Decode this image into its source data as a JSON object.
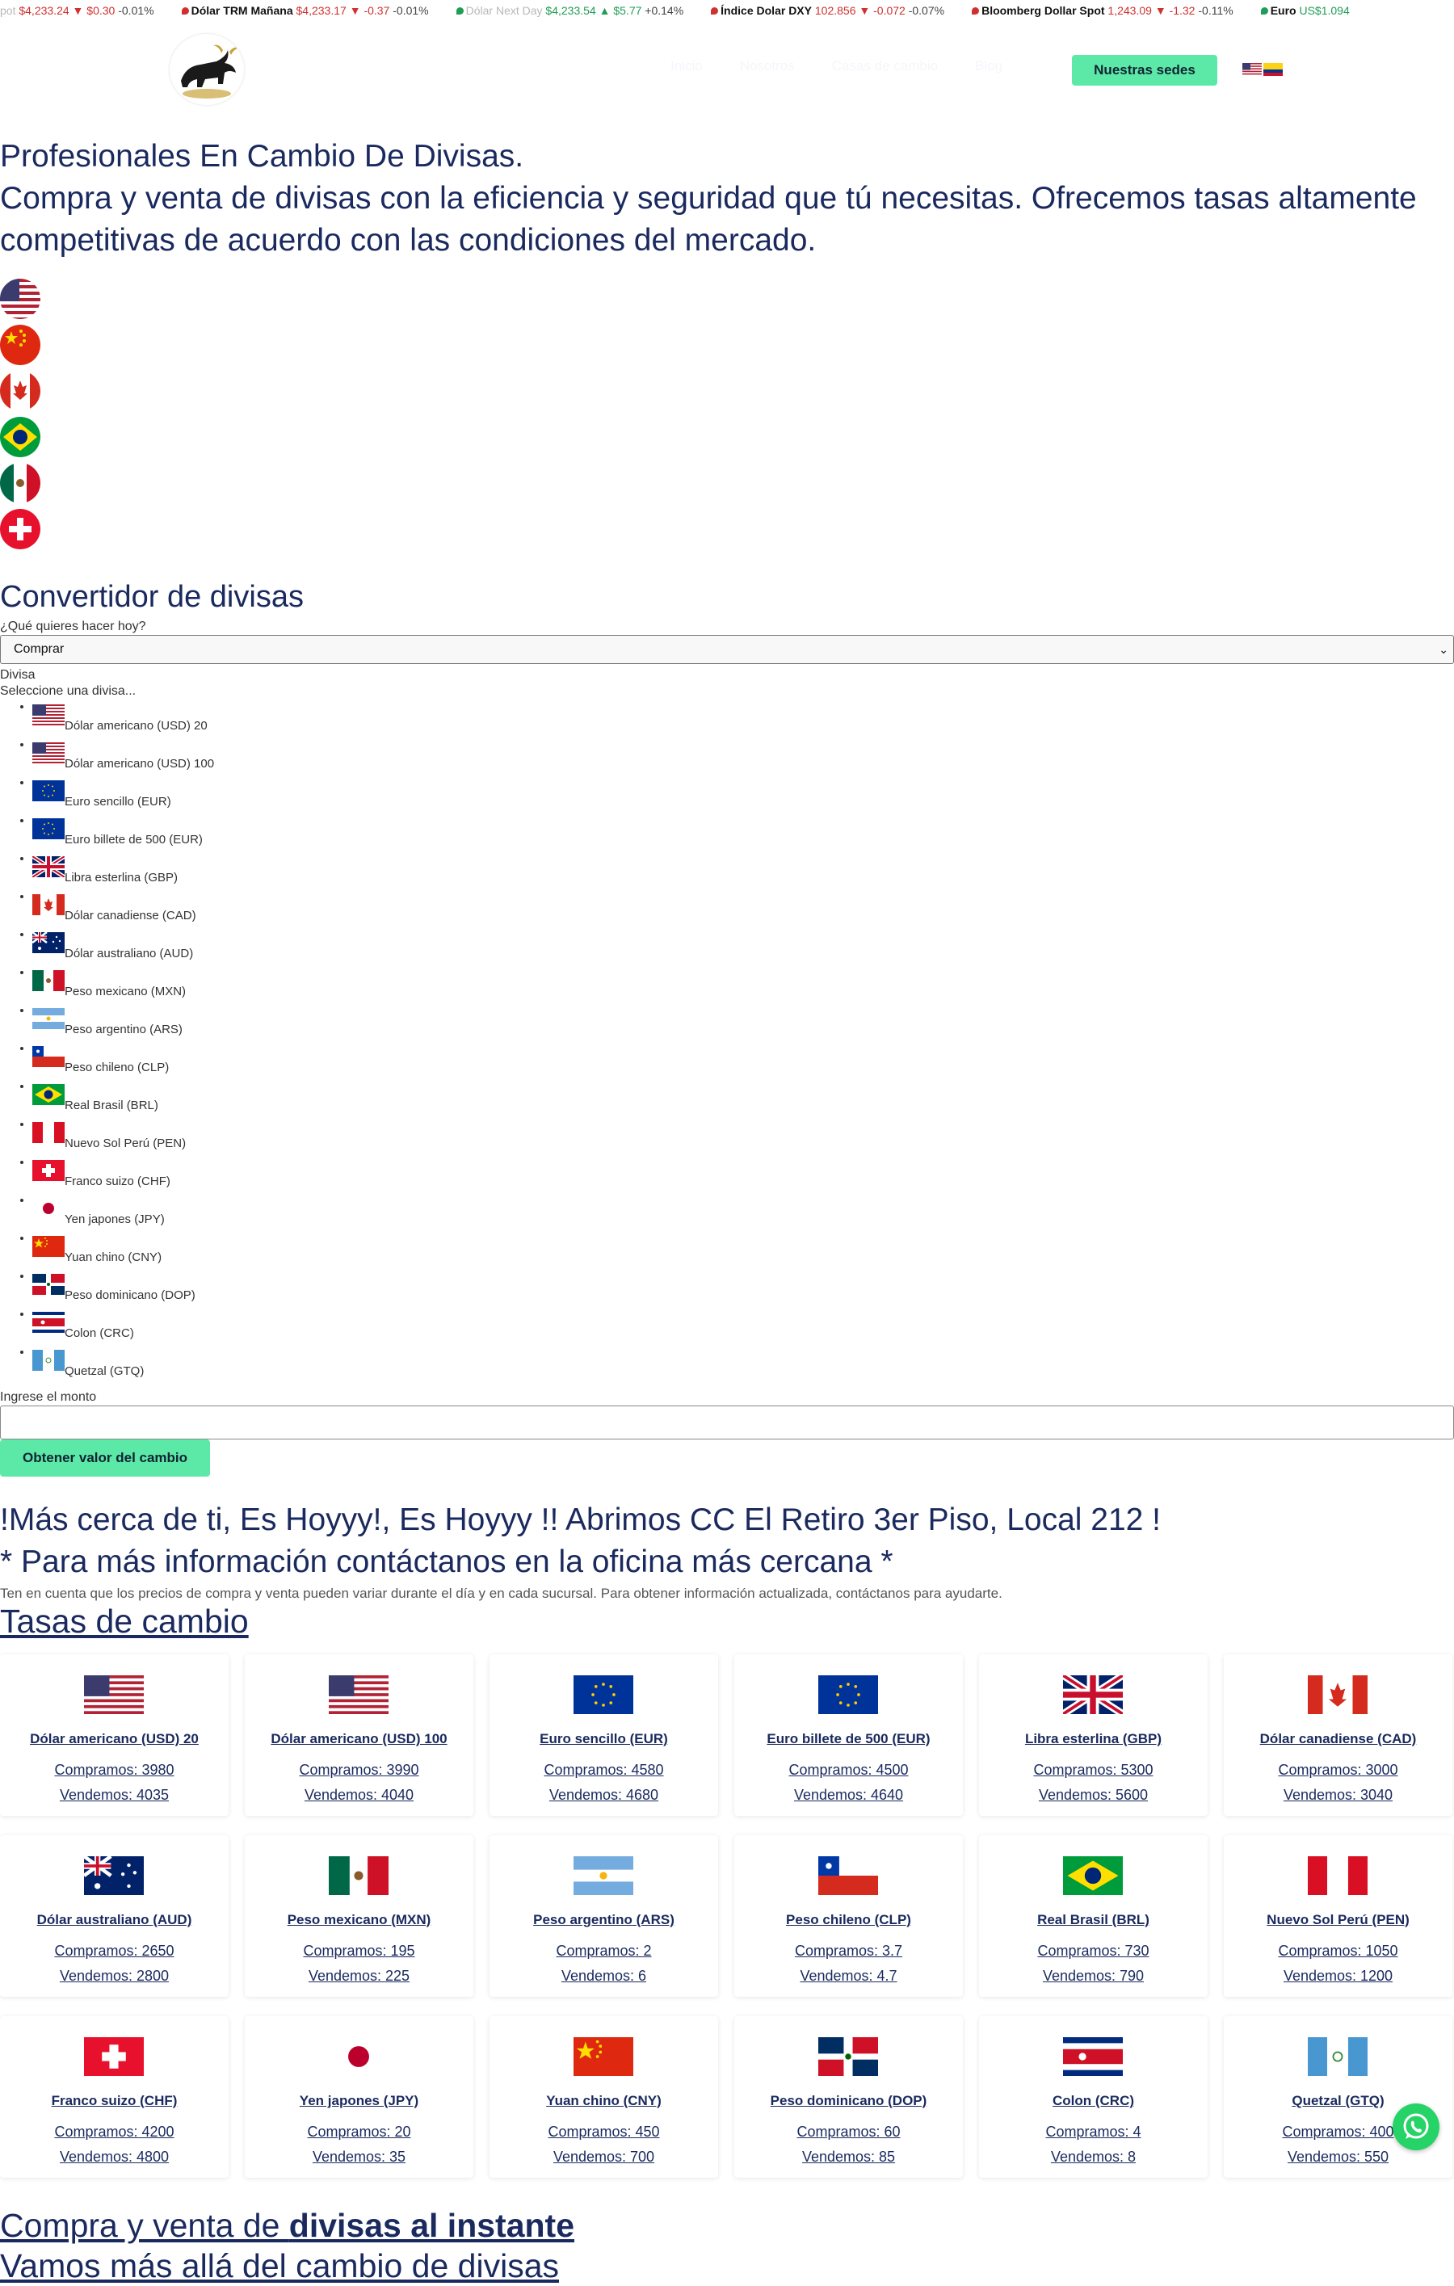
{
  "ticker": [
    {
      "pre": "pot",
      "name": "",
      "price": "$4,233.24",
      "dir": "down",
      "change": "$0.30",
      "pct": "-0.01%",
      "fade": true
    },
    {
      "pre": "",
      "name": "Dólar TRM Mañana",
      "price": "$4,233.17",
      "dir": "down",
      "change": "-0.37",
      "pct": "-0.01%"
    },
    {
      "pre": "",
      "name": "Dólar Next Day",
      "price": "$4,233.54",
      "dir": "up",
      "change": "$5.77",
      "pct": "+0.14%",
      "fade": true
    },
    {
      "pre": "",
      "name": "Índice Dolar DXY",
      "price": "102.856",
      "dir": "down",
      "change": "-0.072",
      "pct": "-0.07%"
    },
    {
      "pre": "",
      "name": "Bloomberg Dollar Spot",
      "price": "1,243.09",
      "dir": "down",
      "change": "-1.32",
      "pct": "-0.11%"
    },
    {
      "pre": "",
      "name": "Euro",
      "price": "US$1.094",
      "dir": "up",
      "change": "",
      "pct": ""
    }
  ],
  "nav": {
    "items": [
      "Inicio",
      "Nosotros",
      "Casas de cambio",
      "Blog"
    ],
    "sedes_label": "Nuestras sedes"
  },
  "hero": {
    "title": "Profesionales En Cambio De Divisas.",
    "subtitle": "Compra y venta de divisas con la eficiencia y seguridad que tú necesitas. Ofrecemos tasas altamente competitivas de acuerdo con las condiciones del mercado."
  },
  "converter": {
    "title": "Convertidor de divisas",
    "question": "¿Qué quieres hacer hoy?",
    "selected_action": "Comprar",
    "divisa_label": "Divisa",
    "divisa_placeholder": "Seleccione una divisa...",
    "divisas": [
      "Dólar americano (USD) 20",
      "Dólar americano (USD) 100",
      "Euro sencillo (EUR)",
      "Euro billete de 500 (EUR)",
      "Libra esterlina (GBP)",
      "Dólar canadiense (CAD)",
      "Dólar australiano (AUD)",
      "Peso mexicano (MXN)",
      "Peso argentino (ARS)",
      "Peso chileno (CLP)",
      "Real Brasil (BRL)",
      "Nuevo Sol Perú (PEN)",
      "Franco suizo (CHF)",
      "Yen japones (JPY)",
      "Yuan chino (CNY)",
      "Peso dominicano (DOP)",
      "Colon (CRC)",
      "Quetzal (GTQ)"
    ],
    "monto_label": "Ingrese el monto",
    "button_label": "Obtener valor del cambio"
  },
  "notice": {
    "line1": "!Más cerca de ti, Es Hoyyy!, Es Hoyyy !! Abrimos CC El Retiro 3er Piso, Local 212 !",
    "line2": "* Para más información contáctanos en la oficina más cercana *",
    "small": "Ten en cuenta que los precios de compra y venta pueden variar durante el día y en cada sucursal. Para obtener información actualizada, contáctanos para ayudarte."
  },
  "rates": {
    "title": "Tasas de cambio",
    "buy_prefix": "Compramos: ",
    "sell_prefix": "Vendemos: ",
    "cards": [
      {
        "name": "Dólar americano (USD) 20",
        "flag": "us",
        "buy": "3980",
        "sell": "4035"
      },
      {
        "name": "Dólar americano (USD) 100",
        "flag": "us",
        "buy": "3990",
        "sell": "4040"
      },
      {
        "name": "Euro sencillo (EUR)",
        "flag": "eu",
        "buy": "4580",
        "sell": "4680"
      },
      {
        "name": "Euro billete de 500 (EUR)",
        "flag": "eu",
        "buy": "4500",
        "sell": "4640"
      },
      {
        "name": "Libra esterlina (GBP)",
        "flag": "gb",
        "buy": "5300",
        "sell": "5600"
      },
      {
        "name": "Dólar canadiense (CAD)",
        "flag": "ca",
        "buy": "3000",
        "sell": "3040"
      },
      {
        "name": "Dólar australiano (AUD)",
        "flag": "au",
        "buy": "2650",
        "sell": "2800"
      },
      {
        "name": "Peso mexicano (MXN)",
        "flag": "mx",
        "buy": "195",
        "sell": "225"
      },
      {
        "name": "Peso argentino (ARS)",
        "flag": "ar",
        "buy": "2",
        "sell": "6"
      },
      {
        "name": "Peso chileno (CLP)",
        "flag": "cl",
        "buy": "3.7",
        "sell": "4.7"
      },
      {
        "name": "Real Brasil (BRL)",
        "flag": "br",
        "buy": "730",
        "sell": "790"
      },
      {
        "name": "Nuevo Sol Perú (PEN)",
        "flag": "pe",
        "buy": "1050",
        "sell": "1200"
      },
      {
        "name": "Franco suizo (CHF)",
        "flag": "ch",
        "buy": "4200",
        "sell": "4800"
      },
      {
        "name": "Yen japones (JPY)",
        "flag": "jp",
        "buy": "20",
        "sell": "35"
      },
      {
        "name": "Yuan chino (CNY)",
        "flag": "cn",
        "buy": "450",
        "sell": "700"
      },
      {
        "name": "Peso dominicano (DOP)",
        "flag": "do",
        "buy": "60",
        "sell": "85"
      },
      {
        "name": "Colon (CRC)",
        "flag": "cr",
        "buy": "4",
        "sell": "8"
      },
      {
        "name": "Quetzal (GTQ)",
        "flag": "gt",
        "buy": "400",
        "sell": "550"
      }
    ]
  },
  "footer_heading": {
    "part1": "Compra y venta de ",
    "part1_bold": "divisas al instante",
    "part2": "Vamos más allá del cambio de divisas"
  },
  "colors": {
    "accent": "#5ce8a6",
    "navy": "#1a2a5e",
    "whatsapp": "#25d366",
    "down": "#d03030",
    "up": "#1f9d55"
  }
}
